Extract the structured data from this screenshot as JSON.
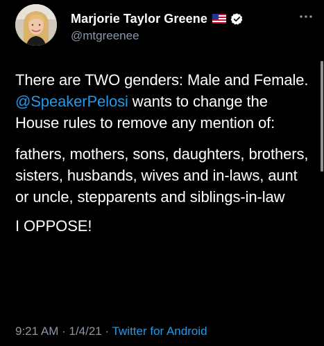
{
  "tweet": {
    "author": {
      "display_name": "Marjorie Taylor Greene",
      "handle": "@mtgreenee",
      "flag_icon": "us-flag-icon",
      "verified_icon": "verified-badge-icon",
      "avatar_icon": "profile-avatar"
    },
    "more_icon": "more-options-icon",
    "body": {
      "p1_a": "There are TWO genders: Male and Female. ",
      "p1_mention": "@SpeakerPelosi",
      "p1_b": " wants to change the House rules to remove any mention of:",
      "p2": "fathers, mothers, sons, daughters, brothers, sisters, husbands, wives and in-laws, aunt or uncle, stepparents and siblings-in-law",
      "p3": "I OPPOSE!"
    },
    "meta": {
      "time": "9:21 AM",
      "separator1": " · ",
      "date": "1/4/21",
      "separator2": " · ",
      "source": "Twitter for Android"
    }
  },
  "colors": {
    "background": "#000000",
    "text": "#ffffff",
    "secondary_text": "#8b98a5",
    "link": "#1d9bf0",
    "verified": "#ffffff"
  }
}
